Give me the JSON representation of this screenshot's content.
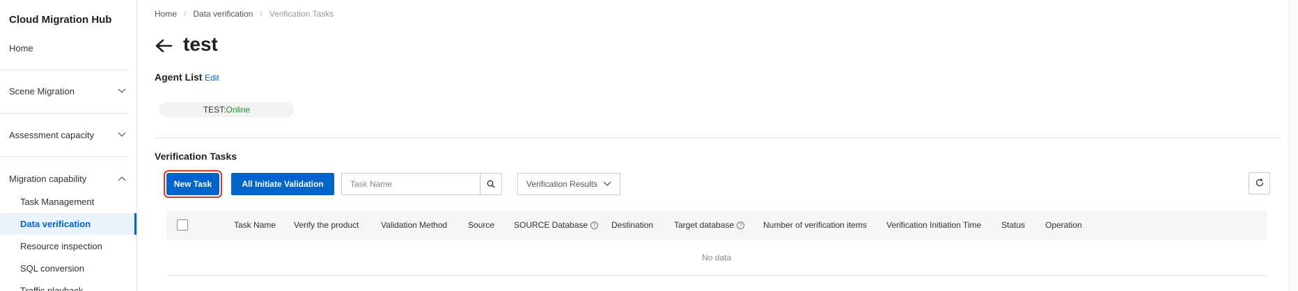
{
  "sidebar": {
    "title": "Cloud Migration Hub",
    "home": "Home",
    "groups": [
      {
        "label": "Scene Migration",
        "expanded": false
      },
      {
        "label": "Assessment capacity",
        "expanded": false
      },
      {
        "label": "Migration capability",
        "expanded": true
      }
    ],
    "sub_items": [
      {
        "label": "Task Management",
        "active": false
      },
      {
        "label": "Data verification",
        "active": true
      },
      {
        "label": "Resource inspection",
        "active": false
      },
      {
        "label": "SQL conversion",
        "active": false
      },
      {
        "label": "Traffic playback",
        "active": false
      }
    ]
  },
  "breadcrumb": [
    "Home",
    "Data verification",
    "Verification Tasks"
  ],
  "page": {
    "title": "test"
  },
  "agents": {
    "label": "Agent List",
    "edit_label": "Edit",
    "items": [
      {
        "name": "TEST:",
        "status": "Online"
      }
    ]
  },
  "tasks": {
    "label": "Verification Tasks",
    "new_button": "New Task",
    "all_button": "All Initiate Validation",
    "search_placeholder": "Task Name",
    "filter_label": "Verification Results",
    "columns": [
      "Task Name",
      "Verify the product",
      "Validation Method",
      "Source",
      "SOURCE Database",
      "Destination",
      "Target database",
      "Number of verification items",
      "Verification Initiation Time",
      "Status",
      "Operation"
    ],
    "empty_text": "No data"
  },
  "colors": {
    "primary": "#0064c8",
    "online": "#1a8c2f",
    "highlight": "#d9362b"
  }
}
